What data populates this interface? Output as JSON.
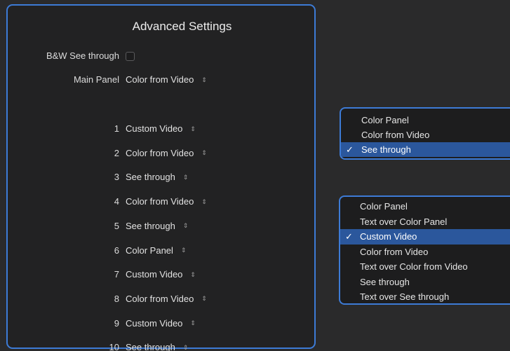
{
  "panel": {
    "title": "Advanced Settings",
    "bw_label": "B&W See through",
    "bw_checked": false,
    "main_panel_label": "Main Panel",
    "main_panel_value": "Color from Video",
    "arrows_glyph": "⇕",
    "rows": [
      {
        "label": "1",
        "value": "Custom Video"
      },
      {
        "label": "2",
        "value": "Color from Video"
      },
      {
        "label": "3",
        "value": "See through"
      },
      {
        "label": "4",
        "value": "Color from Video"
      },
      {
        "label": "5",
        "value": "See through"
      },
      {
        "label": "6",
        "value": "Color Panel"
      },
      {
        "label": "7",
        "value": "Custom Video"
      },
      {
        "label": "8",
        "value": "Color from Video"
      },
      {
        "label": "9",
        "value": "Custom Video"
      },
      {
        "label": "10",
        "value": "See through"
      }
    ]
  },
  "menu_main": {
    "check_glyph": "✓",
    "items": [
      {
        "label": "Color Panel",
        "selected": false
      },
      {
        "label": "Color from Video",
        "selected": false
      },
      {
        "label": "See through",
        "selected": true
      }
    ]
  },
  "menu_row": {
    "check_glyph": "✓",
    "items": [
      {
        "label": "Color Panel",
        "selected": false
      },
      {
        "label": "Text over Color Panel",
        "selected": false
      },
      {
        "label": "Custom Video",
        "selected": true
      },
      {
        "label": "Color from Video",
        "selected": false
      },
      {
        "label": "Text over Color from Video",
        "selected": false
      },
      {
        "label": "See through",
        "selected": false
      },
      {
        "label": "Text over See through",
        "selected": false
      }
    ]
  },
  "colors": {
    "accent_border": "#3d7bd6",
    "selection": "#2b579c",
    "background": "#2a2a2b",
    "panel_bg": "#222223"
  }
}
